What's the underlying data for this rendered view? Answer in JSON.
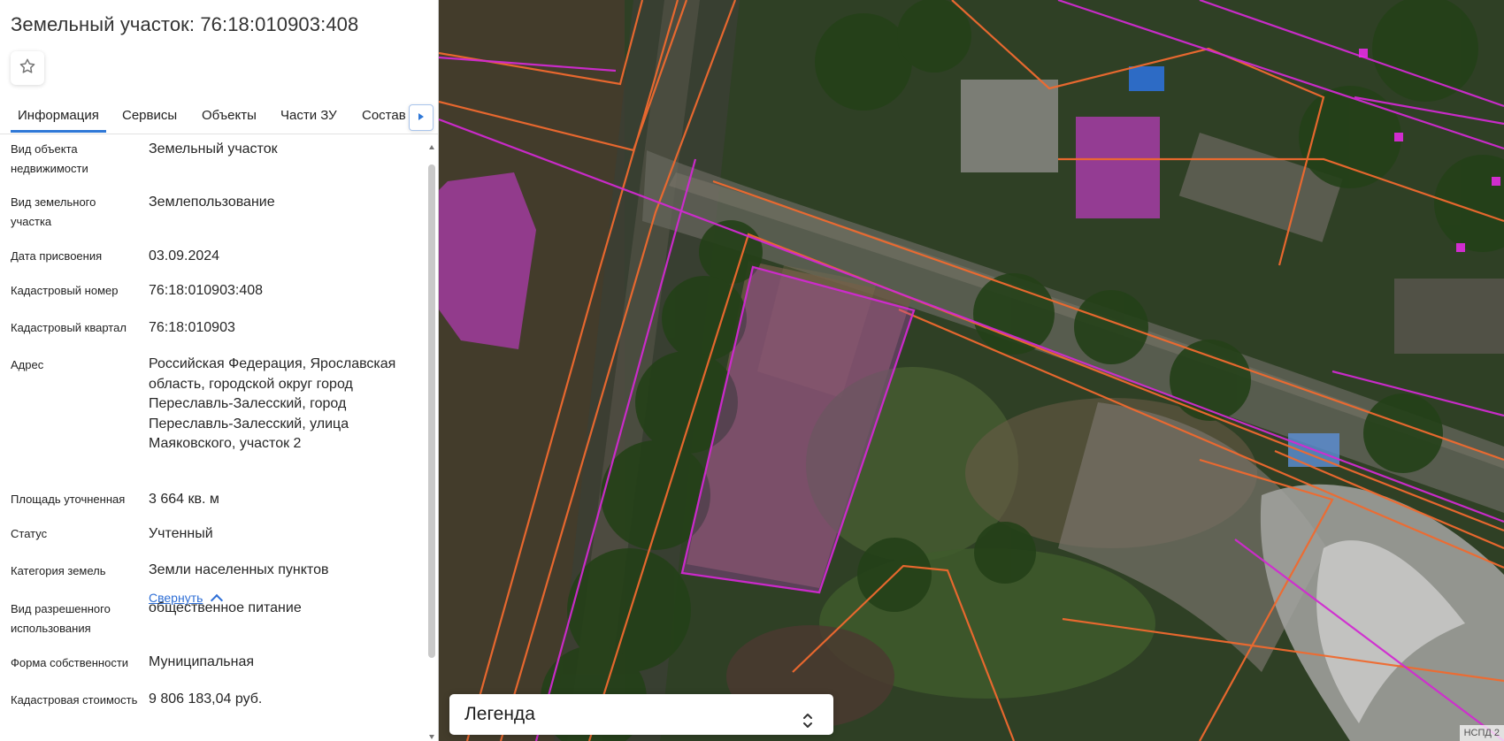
{
  "panel": {
    "title": "Земельный участок: 76:18:010903:408",
    "favorite_icon": "star-outline-icon",
    "tabs": [
      {
        "label": "Информация",
        "active": true
      },
      {
        "label": "Сервисы",
        "active": false
      },
      {
        "label": "Объекты",
        "active": false
      },
      {
        "label": "Части ЗУ",
        "active": false
      },
      {
        "label": "Состав",
        "active": false
      }
    ],
    "tabs_next_icon": "triangle-right-icon",
    "fields": [
      {
        "label": "Вид объекта недвижимости",
        "value": "Земельный участок"
      },
      {
        "label": "Вид земельного участка",
        "value": "Землепользование"
      },
      {
        "label": "Дата присвоения",
        "value": "03.09.2024"
      },
      {
        "label": "Кадастровый номер",
        "value": "76:18:010903:408"
      },
      {
        "label": "Кадастровый квартал",
        "value": "76:18:010903"
      },
      {
        "label": "Адрес",
        "value": "Российская Федерация, Ярославская область, городской округ город Переславль-Залесский, город Переславль-Залесский, улица Маяковского, участок 2"
      },
      {
        "label": "Площадь уточненная",
        "value": "3 664 кв. м"
      },
      {
        "label": "Статус",
        "value": "Учтенный"
      },
      {
        "label": "Категория земель",
        "value": "Земли населенных пунктов"
      },
      {
        "label": "Вид разрешенного использования",
        "value": "общественное питание"
      },
      {
        "label": "Форма собственности",
        "value": "Муниципальная"
      },
      {
        "label": "Кадастровая стоимость",
        "value": "9 806 183,04 руб."
      }
    ],
    "collapse_link": "Свернуть"
  },
  "map": {
    "legend_label": "Легенда",
    "legend_icon": "up-down-chevron-icon",
    "attribution": "НСПД 2",
    "colors": {
      "parcel_border": "#f06a2f",
      "building_border": "#d12ad1",
      "building_fill": "#c637c5",
      "accent": "#2f78d7"
    }
  }
}
